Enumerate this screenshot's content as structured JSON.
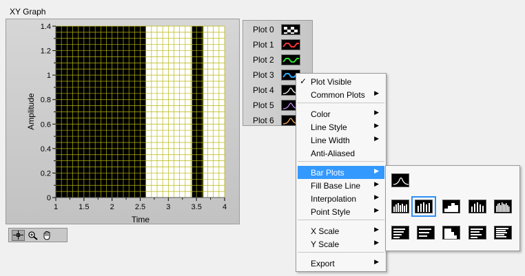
{
  "graph": {
    "title": "XY Graph",
    "x_axis_label": "Time",
    "y_axis_label": "Amplitude",
    "x_ticks": [
      "1",
      "1.5",
      "2",
      "2.5",
      "3",
      "3.5",
      "4"
    ],
    "y_ticks": [
      "0",
      "0.2",
      "0.4",
      "0.6",
      "0.8",
      "1",
      "1.2",
      "1.4"
    ]
  },
  "chart_data": {
    "type": "bar",
    "xlabel": "Time",
    "ylabel": "Amplitude",
    "xlim": [
      1,
      4
    ],
    "ylim": [
      0,
      1.4
    ],
    "grid": true,
    "x_ticks": [
      1,
      1.5,
      2,
      2.5,
      3,
      3.5,
      4
    ],
    "y_ticks": [
      0,
      0.2,
      0.4,
      0.6,
      0.8,
      1,
      1.2,
      1.4
    ],
    "colors": {
      "plot_area": "#ffffff",
      "filled_region": "#000000",
      "grid": "#b6b60c"
    },
    "filled_ranges_x": [
      [
        1,
        2.6
      ],
      [
        3.42,
        3.62
      ]
    ]
  },
  "graph_tools": {
    "items": [
      {
        "icon": "crosshair-cursor-icon",
        "active": true
      },
      {
        "icon": "zoom-icon",
        "active": false
      },
      {
        "icon": "pan-hand-icon",
        "active": false
      }
    ]
  },
  "legend": {
    "plots": [
      {
        "label": "Plot 0",
        "color": "#ffffff",
        "pattern": "checker"
      },
      {
        "label": "Plot 1",
        "color": "#ff3333",
        "pattern": "wave"
      },
      {
        "label": "Plot 2",
        "color": "#33dd33",
        "pattern": "wave"
      },
      {
        "label": "Plot 3",
        "color": "#33aaff",
        "pattern": "wave"
      },
      {
        "label": "Plot 4",
        "color": "#ffffff",
        "pattern": "bell"
      },
      {
        "label": "Plot 5",
        "color": "#cc88ff",
        "pattern": "bell"
      },
      {
        "label": "Plot 6",
        "color": "#ffb366",
        "pattern": "bell"
      }
    ]
  },
  "context_menu": {
    "items": [
      {
        "label": "Plot Visible",
        "checked": true,
        "submenu": false
      },
      {
        "label": "Common Plots",
        "checked": false,
        "submenu": true
      },
      {
        "label": "Color",
        "checked": false,
        "submenu": true
      },
      {
        "label": "Line Style",
        "checked": false,
        "submenu": true
      },
      {
        "label": "Line Width",
        "checked": false,
        "submenu": true
      },
      {
        "label": "Anti-Aliased",
        "checked": false,
        "submenu": false
      },
      {
        "label": "Bar Plots",
        "checked": false,
        "submenu": true,
        "highlighted": true
      },
      {
        "label": "Fill Base Line",
        "checked": false,
        "submenu": true
      },
      {
        "label": "Interpolation",
        "checked": false,
        "submenu": true
      },
      {
        "label": "Point Style",
        "checked": false,
        "submenu": true
      },
      {
        "label": "X Scale",
        "checked": false,
        "submenu": true
      },
      {
        "label": "Y Scale",
        "checked": false,
        "submenu": true
      },
      {
        "label": "Export",
        "checked": false,
        "submenu": true
      }
    ],
    "check_glyph": "✓",
    "arrow_glyph": "▶",
    "highlight_color": "#3399ff"
  },
  "bar_plots_palette": {
    "options": [
      {
        "icon": "no-bars-icon",
        "selected": false
      },
      {
        "icon": "vertical-bars-full-icon",
        "selected": false
      },
      {
        "icon": "vertical-bars-spaced-icon",
        "selected": true
      },
      {
        "icon": "vertical-bars-stepped-icon",
        "selected": false
      },
      {
        "icon": "vertical-bars-narrow-icon",
        "selected": false
      },
      {
        "icon": "vertical-bars-dense-icon",
        "selected": false
      },
      {
        "icon": "horizontal-bars-full-icon",
        "selected": false
      },
      {
        "icon": "horizontal-bars-spaced-icon",
        "selected": false
      },
      {
        "icon": "horizontal-bars-stepped-icon",
        "selected": false
      },
      {
        "icon": "horizontal-bars-narrow-icon",
        "selected": false
      },
      {
        "icon": "horizontal-bars-dense-icon",
        "selected": false
      }
    ],
    "selection_color": "#2f8ff5"
  }
}
